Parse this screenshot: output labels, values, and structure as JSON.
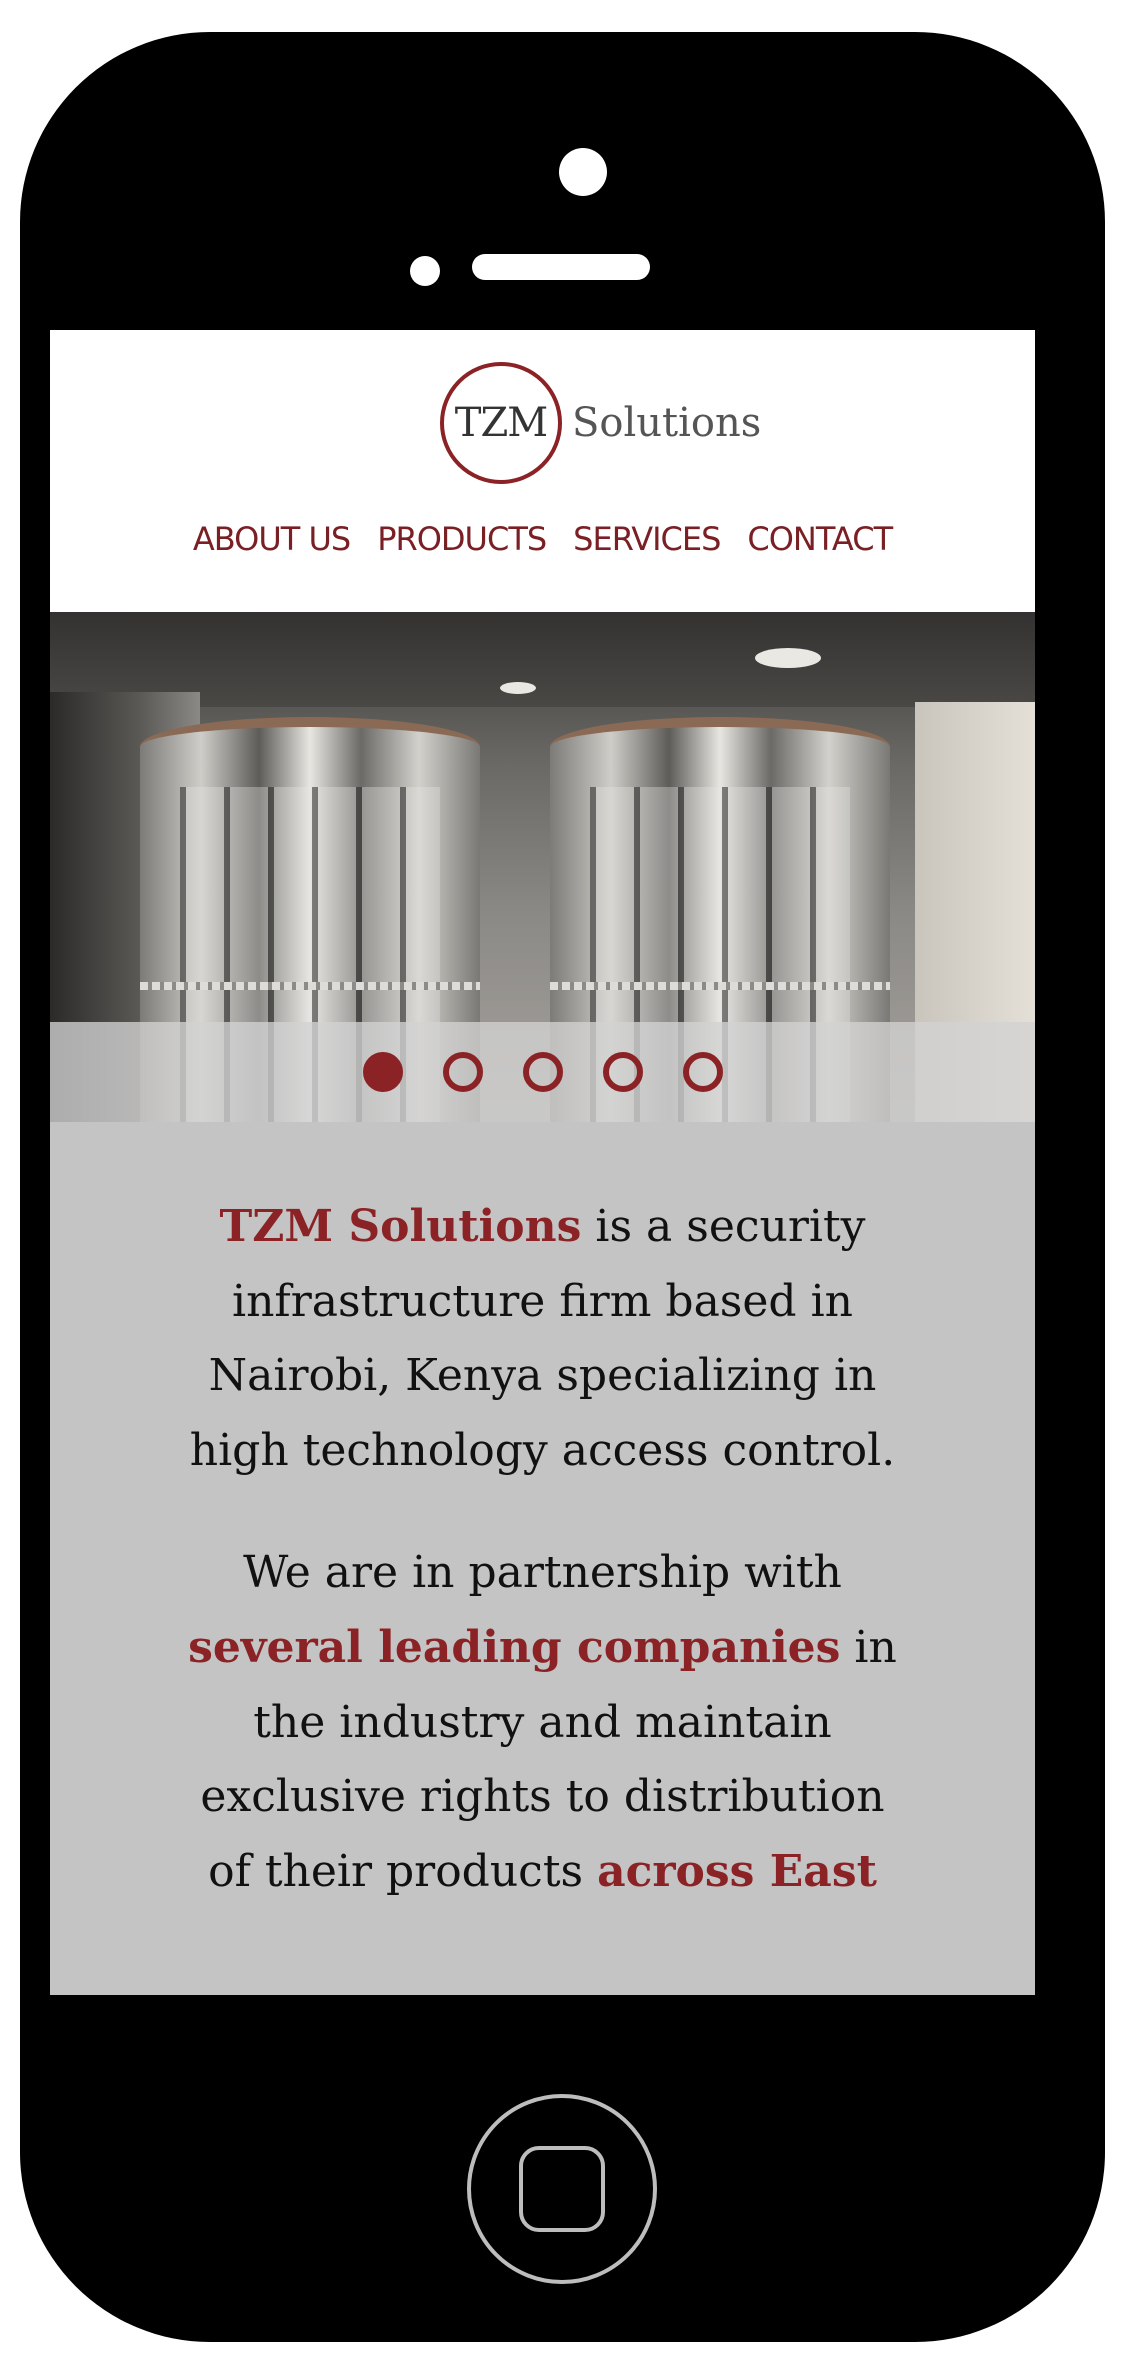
{
  "brand": {
    "logo_mark": "TZM",
    "logo_word": "Solutions",
    "accent_color": "#8b2326"
  },
  "nav": {
    "items": [
      {
        "label": "ABOUT US"
      },
      {
        "label": "PRODUCTS"
      },
      {
        "label": "SERVICES"
      },
      {
        "label": "CONTACT"
      }
    ]
  },
  "carousel": {
    "slide_count": 5,
    "active_index": 0
  },
  "intro": {
    "p1": {
      "highlight": "TZM Solutions",
      "rest": " is a security infrastructure firm based in Nairobi, Kenya specializing in high technology access control."
    },
    "p2": {
      "lead": "We are in partnership with ",
      "highlight1": "several leading companies",
      "middle": " in the industry and maintain exclusive rights to distribution of their products ",
      "highlight2": "across East"
    }
  }
}
